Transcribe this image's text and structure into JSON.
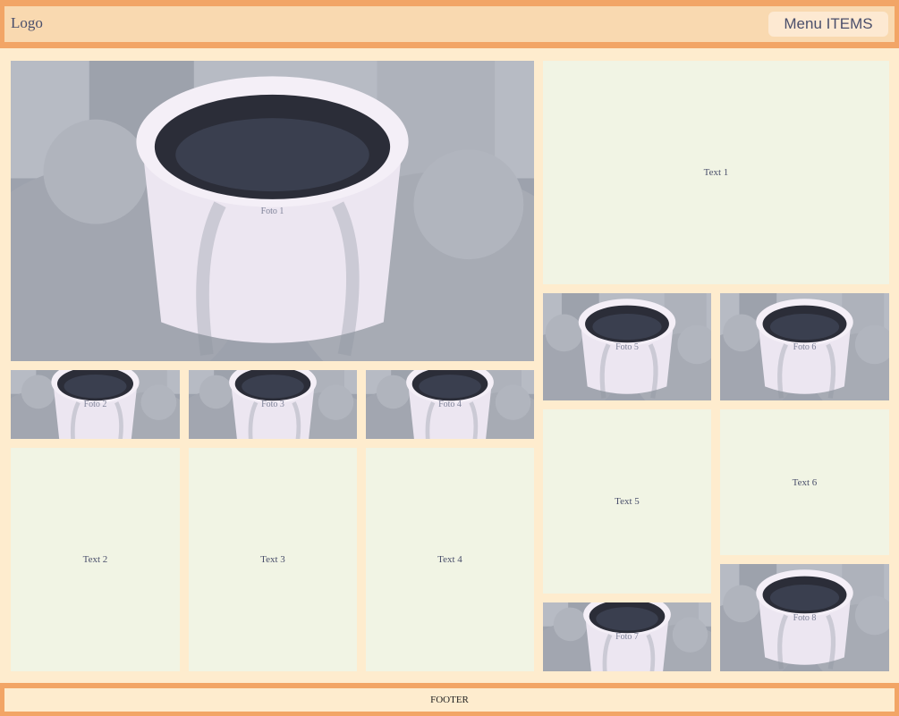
{
  "header": {
    "logo": "Logo",
    "menu_label": "Menu ITEMS"
  },
  "tiles": {
    "foto1": "Foto 1",
    "foto2": "Foto 2",
    "foto3": "Foto 3",
    "foto4": "Foto 4",
    "foto5": "Foto 5",
    "foto6": "Foto 6",
    "foto7": "Foto 7",
    "foto8": "Foto 8",
    "text1": "Text 1",
    "text2": "Text 2",
    "text3": "Text 3",
    "text4": "Text 4",
    "text5": "Text 5",
    "text6": "Text 6"
  },
  "footer": {
    "label": "FOOTER"
  },
  "colors": {
    "header_border": "#f2a566",
    "header_fill": "#f9d9b0",
    "page_bg": "#feecce",
    "text_tile": "#f1f4e4"
  }
}
